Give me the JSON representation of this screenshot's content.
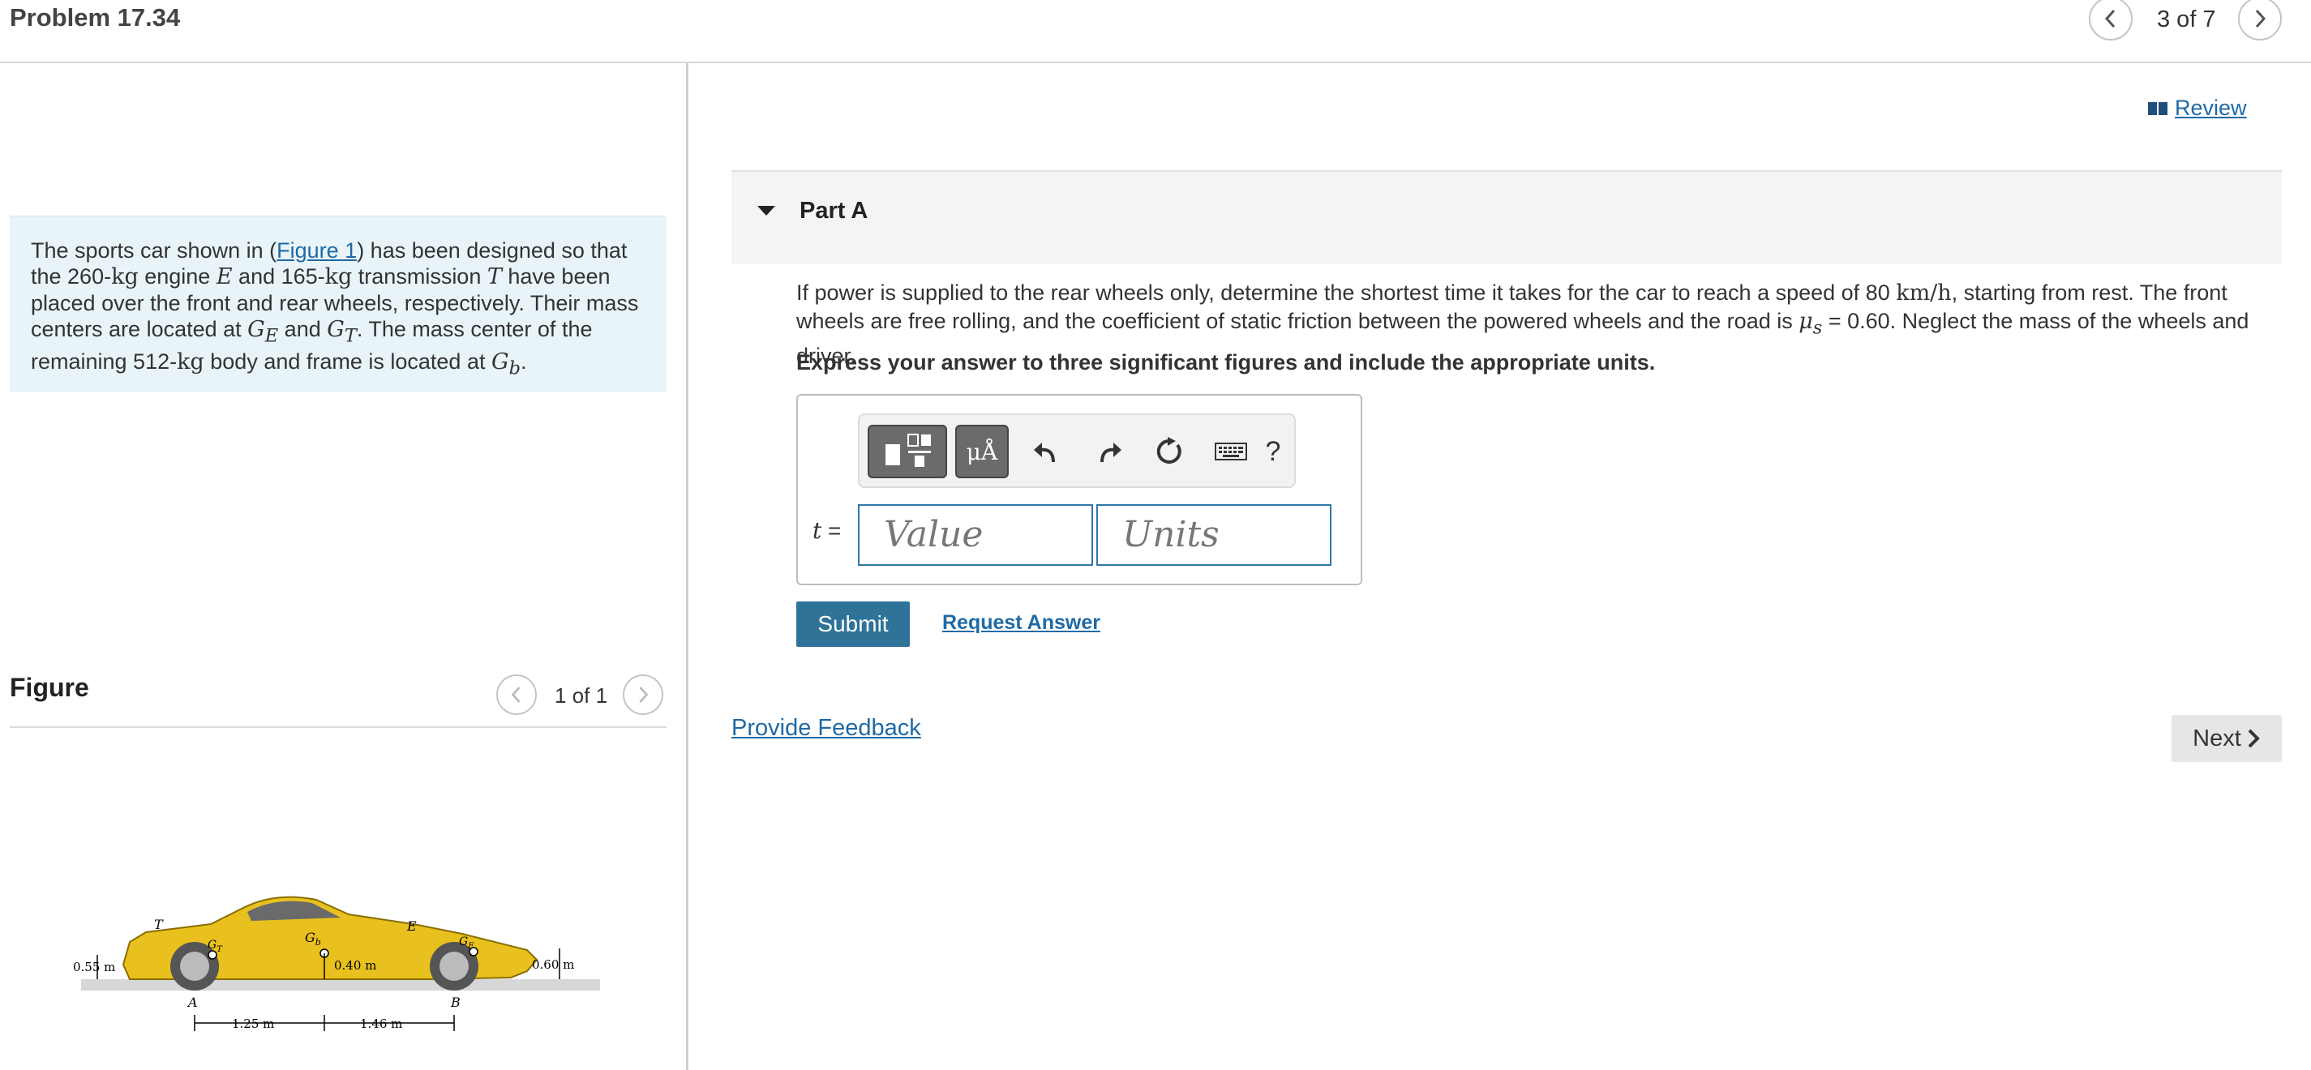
{
  "header": {
    "title": "Problem 17.34",
    "pager": "3 of 7"
  },
  "intro": {
    "t1": "The sports car shown in (",
    "figure_link": "Figure 1",
    "t2": ") has been designed so that the 260-",
    "kg": "kg",
    "t3": " engine ",
    "E": "E",
    "t4": " and 165-",
    "t5": " transmission ",
    "T": "T",
    "t6": " have been placed over the front and rear wheels, respectively. Their mass centers are located at ",
    "GE": "G",
    "GE_sub": "E",
    "t7": " and ",
    "GT": "G",
    "GT_sub": "T",
    "t8": ". The mass center of the remaining 512-",
    "t9": " body and frame is located at ",
    "Gb": "G",
    "Gb_sub": "b",
    "t10": "."
  },
  "figure": {
    "title": "Figure",
    "pager": "1 of 1",
    "labels": {
      "T": "T",
      "Gb": "G",
      "Gb_sub": "b",
      "E": "E",
      "GT": "G",
      "GT_sub": "T",
      "GE": "G",
      "GE_sub": "E",
      "A": "A",
      "B": "B",
      "d055": "0.55 m",
      "d040": "0.40 m",
      "d060": "0.60 m",
      "d125": "1.25 m",
      "d146": "1.46 m"
    }
  },
  "review": {
    "label": "Review"
  },
  "part": {
    "label": "Part A"
  },
  "question": {
    "q1": "If power is supplied to the rear wheels only, determine the shortest time it takes for the car to reach a speed of 80 ",
    "unit": "km/h",
    "q2": ", starting from rest. The front wheels are free rolling, and the coefficient of static friction between the powered wheels and the road is ",
    "mu": "μ",
    "mu_sub": "s",
    "q3": " = 0.60. Neglect the mass of the wheels and driver.",
    "instruction": "Express your answer to three significant figures and include the appropriate units."
  },
  "answer": {
    "toolbar": {
      "symbols_label": "μÅ",
      "help_label": "?"
    },
    "var_label": "t",
    "equals": " =",
    "value_placeholder": "Value",
    "units_placeholder": "Units"
  },
  "actions": {
    "submit": "Submit",
    "request_answer": "Request Answer",
    "provide_feedback": "Provide Feedback",
    "next": "Next"
  }
}
